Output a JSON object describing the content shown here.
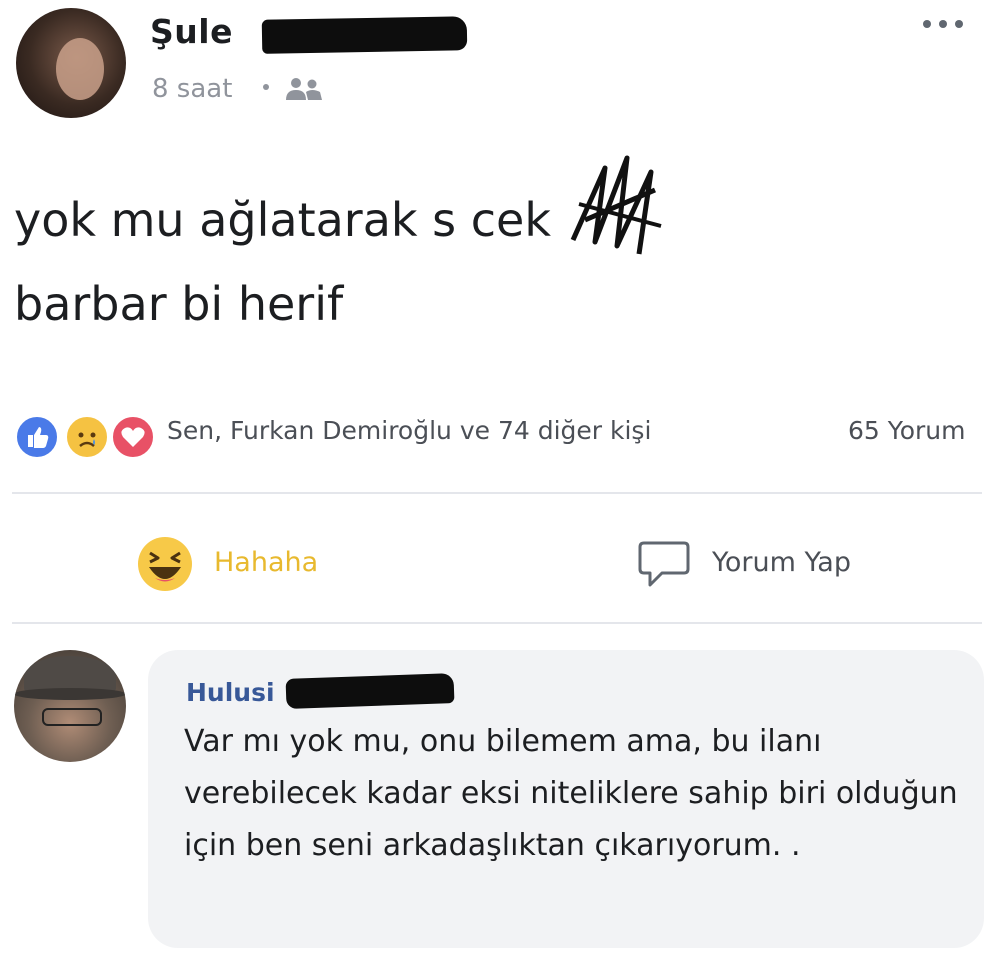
{
  "post": {
    "author": "Şule",
    "time": "8 saat",
    "privacy_icon": "friends-icon",
    "more_icon": "more-horizontal-icon",
    "text_line1": "yok mu ağlatarak s  cek",
    "text_line2": "barbar bi herif"
  },
  "reactions": {
    "icons": [
      "like-icon",
      "sad-icon",
      "love-icon"
    ],
    "names": "Sen, Furkan Demiroğlu ve 74 diğer kişi",
    "comment_count": "65 Yorum"
  },
  "actions": {
    "reaction_label": "Hahaha",
    "comment_label": "Yorum Yap"
  },
  "comment": {
    "author": "Hulusi",
    "text": "Var mı yok mu, onu bilemem ama, bu ilanı verebilecek kadar eksi niteliklere sahip biri olduğun için ben seni arkadaşlıktan çıkarıyorum. ."
  },
  "colors": {
    "like_blue": "#4a7ae8",
    "haha_yellow": "#e8b92e",
    "love_red": "#e85166",
    "link_blue": "#385898",
    "muted_gray": "#90949c"
  }
}
